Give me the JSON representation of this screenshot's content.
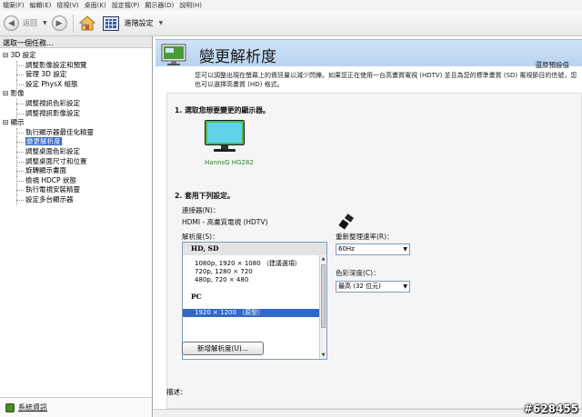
{
  "menubar": {
    "items": [
      "檔案(F)",
      "編輯(E)",
      "檢視(V)",
      "桌面(K)",
      "設定檔(P)",
      "顯示器(D)",
      "說明(H)"
    ]
  },
  "toolbar": {
    "back_label": "返回",
    "advanced_label": "進階設定"
  },
  "sidebar": {
    "header": "選取一個任務...",
    "tree": [
      {
        "type": "cat",
        "label": "3D 設定"
      },
      {
        "type": "item",
        "label": "調整影像設定和預覽"
      },
      {
        "type": "item",
        "label": "管理 3D 設定"
      },
      {
        "type": "item",
        "label": "設定 PhysX 組態"
      },
      {
        "type": "cat",
        "label": "影像"
      },
      {
        "type": "item",
        "label": "調整視訊色彩設定"
      },
      {
        "type": "item",
        "label": "調整視訊影像設定"
      },
      {
        "type": "cat",
        "label": "顯示"
      },
      {
        "type": "item",
        "label": "執行顯示器最佳化精靈"
      },
      {
        "type": "item",
        "label": "變更解析度",
        "selected": true
      },
      {
        "type": "item",
        "label": "調整桌面色彩設定"
      },
      {
        "type": "item",
        "label": "調整桌面尺寸和位置"
      },
      {
        "type": "item",
        "label": "旋轉顯示畫面"
      },
      {
        "type": "item",
        "label": "檢視 HDCP 狀態"
      },
      {
        "type": "item",
        "label": "執行電視安裝精靈"
      },
      {
        "type": "item",
        "label": "設定多台顯示器"
      }
    ],
    "footer_link": "系統資訊"
  },
  "main": {
    "title": "變更解析度",
    "restore_link": "還原預設值",
    "description": "您可以調整出現在螢幕上的資訊量以減少閃爍。如果您正在使用一台高畫質電視 (HDTV) 並且為您的標準畫質 (SD) 電視節目的信號，您也可以選擇高畫質 (HD) 格式。",
    "section1_title": "1. 選取您想要變更的顯示器。",
    "monitor_name": "HannsG HG282",
    "section2_title": "2. 套用下列設定。",
    "connector_label": "連接器(N)：",
    "connector_value": "HDMI - 高畫質電視 (HDTV)",
    "resolution_label": "解析度(S)：",
    "resolution_list": {
      "group1": "HD, SD",
      "group1_items": [
        "1080p, 1920 × 1080 （建議選項）",
        "720p, 1280 × 720",
        "480p, 720 × 480"
      ],
      "group2": "PC",
      "selected_item": "1920 × 1200 （原型）"
    },
    "refresh_label": "重新整理速率(R)：",
    "refresh_value": "60Hz",
    "color_depth_label": "色彩深度(C)：",
    "color_depth_value": "最高 (32 位元)",
    "custom_button": "新增解析度(U)...",
    "desc_label": "描述："
  },
  "watermark": "#628455",
  "colors": {
    "selection": "#3169c6",
    "banner": "#c4dbf3"
  }
}
